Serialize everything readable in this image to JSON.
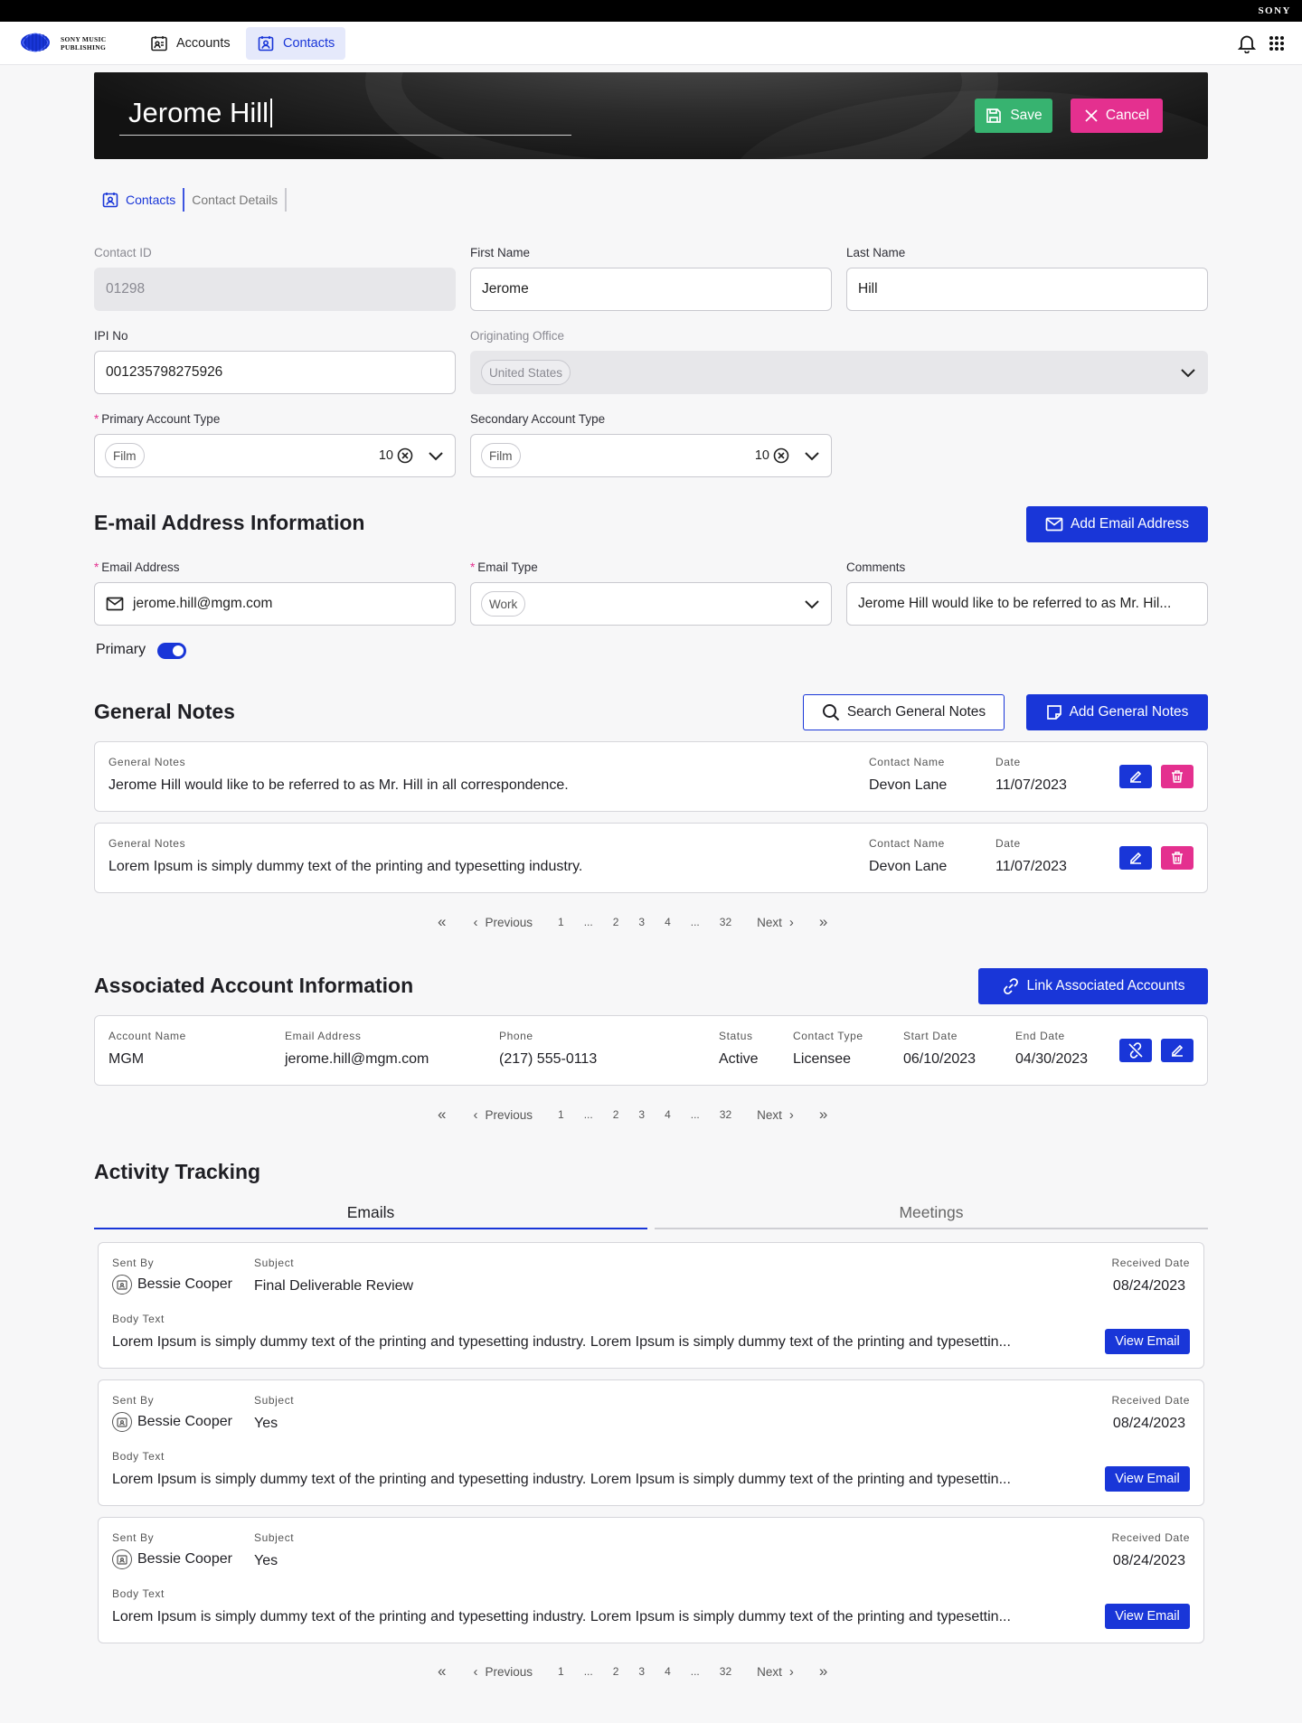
{
  "brand": {
    "corner_logo": "SONY",
    "app_logo_line1": "SONY MUSIC",
    "app_logo_line2": "PUBLISHING"
  },
  "nav": {
    "accounts": "Accounts",
    "contacts": "Contacts",
    "icons": [
      "bell-icon",
      "apps-grid-icon"
    ]
  },
  "header": {
    "contact_name": "Jerome Hill",
    "save": "Save",
    "cancel": "Cancel"
  },
  "subtabs": {
    "contacts": "Contacts",
    "details": "Contact Details"
  },
  "form": {
    "contact_id_label": "Contact ID",
    "contact_id": "01298",
    "first_name_label": "First Name",
    "first_name": "Jerome",
    "last_name_label": "Last Name",
    "last_name": "Hill",
    "ipi_label": "IPI No",
    "ipi": "001235798275926",
    "office_label": "Originating Office",
    "office": "United States",
    "primary_type_label": "Primary Account Type",
    "primary_type": "Film",
    "primary_count": "10",
    "secondary_type_label": "Secondary Account Type",
    "secondary_type": "Film",
    "secondary_count": "10"
  },
  "email_section": {
    "title": "E-mail Address Information",
    "add_button": "Add Email Address",
    "email_label": "Email Address",
    "email": "jerome.hill@mgm.com",
    "type_label": "Email Type",
    "type": "Work",
    "comments_label": "Comments",
    "comments": "Jerome Hill would like to be referred to as Mr. Hil...",
    "primary_label": "Primary"
  },
  "notes_section": {
    "title": "General Notes",
    "search_button": "Search General Notes",
    "add_button": "Add General Notes",
    "col_notes": "General Notes",
    "col_contact": "Contact Name",
    "col_date": "Date",
    "rows": [
      {
        "note": "Jerome Hill would like to be referred to as Mr. Hill in all correspondence.",
        "contact": "Devon Lane",
        "date": "11/07/2023"
      },
      {
        "note": "Lorem Ipsum is simply dummy text of the printing and typesetting industry.",
        "contact": "Devon Lane",
        "date": "11/07/2023"
      }
    ]
  },
  "pager": {
    "first": "«",
    "previous": "Previous",
    "pages": [
      "1",
      "...",
      "2",
      "3",
      "4",
      "...",
      "32"
    ],
    "next": "Next",
    "last": "»"
  },
  "assoc_section": {
    "title": "Associated Account Information",
    "link_button": "Link Associated Accounts",
    "col_account": "Account Name",
    "col_email": "Email Address",
    "col_phone": "Phone",
    "col_status": "Status",
    "col_type": "Contact Type",
    "col_start": "Start Date",
    "col_end": "End Date",
    "row": {
      "account": "MGM",
      "email": "jerome.hill@mgm.com",
      "phone": "(217) 555-0113",
      "status": "Active",
      "type": "Licensee",
      "start": "06/10/2023",
      "end": "04/30/2023"
    }
  },
  "activity": {
    "title": "Activity Tracking",
    "tab_emails": "Emails",
    "tab_meetings": "Meetings",
    "col_sent_by": "Sent By",
    "col_subject": "Subject",
    "col_received": "Received Date",
    "col_body": "Body Text",
    "view_button": "View Email",
    "emails": [
      {
        "sender": "Bessie Cooper",
        "subject": "Final Deliverable Review",
        "date": "08/24/2023",
        "body": "Lorem Ipsum is simply dummy text of the printing and typesetting industry. Lorem Ipsum is simply dummy text of the printing and typesettin..."
      },
      {
        "sender": "Bessie Cooper",
        "subject": "Yes",
        "date": "08/24/2023",
        "body": "Lorem Ipsum is simply dummy text of the printing and typesetting industry. Lorem Ipsum is simply dummy text of the printing and typesettin..."
      },
      {
        "sender": "Bessie Cooper",
        "subject": "Yes",
        "date": "08/24/2023",
        "body": "Lorem Ipsum is simply dummy text of the printing and typesetting industry. Lorem Ipsum is simply dummy text of the printing and typesettin..."
      }
    ]
  },
  "colors": {
    "accent": "#1936d8",
    "save": "#37b370",
    "cancel": "#e4308f"
  }
}
